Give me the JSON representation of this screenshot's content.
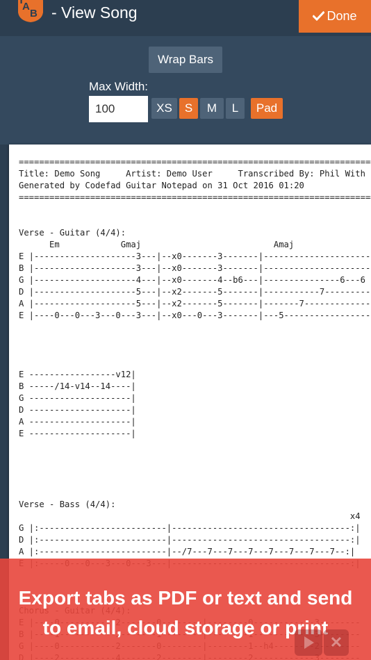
{
  "header": {
    "logo_text": "TAB",
    "title": "- View Song",
    "done_label": "Done"
  },
  "controls": {
    "wrap_bars_label": "Wrap Bars",
    "max_width_label": "Max Width:",
    "max_width_value": "100",
    "sizes": [
      {
        "label": "XS",
        "active": false
      },
      {
        "label": "S",
        "active": true
      },
      {
        "label": "M",
        "active": false
      },
      {
        "label": "L",
        "active": false
      }
    ],
    "pad_label": "Pad"
  },
  "tab_document": {
    "text": "=======================================================================\nTitle: Demo Song     Artist: Demo User     Transcribed By: Phil With\nGenerated by Codefad Guitar Notepad on 31 Oct 2016 01:20\n=======================================================================\n\n\nVerse - Guitar (4/4):\n      Em            Gmaj                          Amaj\nE |--------------------3---|--x0-------3-------|---------------------\nB |--------------------3---|--x0-------3-------|---------------------\nG |--------------------4---|--x0-------4--b6---|---------------6---6\nD |--------------------5---|--x2-------5-------|-----------7---------\nA |--------------------5---|--x2-------5-------|-------7-------------\nE |----0---0---3---0---3---|--x0---0---3-------|---5-----------------\n\n\n\n\nE -----------------v12|\nB -----/14-v14--14----|\nG --------------------|\nD --------------------|\nA --------------------|\nE --------------------|\n\n\n\n\n\nVerse - Bass (4/4):\n                                                                 x4\nG |:-------------------------|-----------------------------------:|\nD |:-------------------------|-----------------------------------:|\nA |:-------------------------|--/7---7---7---7---7---7---7---7--:|\nE |:-----0---0---3---0---3---|-----------------------------------:|\n\n\n\nChorus - Guitar (4/4):\nE |----0-----------2-------0--------|--------0------------3--------\nB |----1-----------3-------1--------|--------1------------3--------\nG |----0-----------2-------0--------|--------1--h4--------2--------\nD |----2-----------4-------2--------|--------2------------3--------\nA |----2-----------2-------2--------|--------3------------3--------"
  },
  "promo": {
    "line1": "Export tabs as PDF or text and send",
    "line2": "to email, cloud storage or print"
  },
  "colors": {
    "header_bg": "#2c3e50",
    "controls_bg": "#34495e",
    "accent": "#e8712b",
    "button_bg": "#4e6378",
    "promo_bg": "#e8463c"
  }
}
